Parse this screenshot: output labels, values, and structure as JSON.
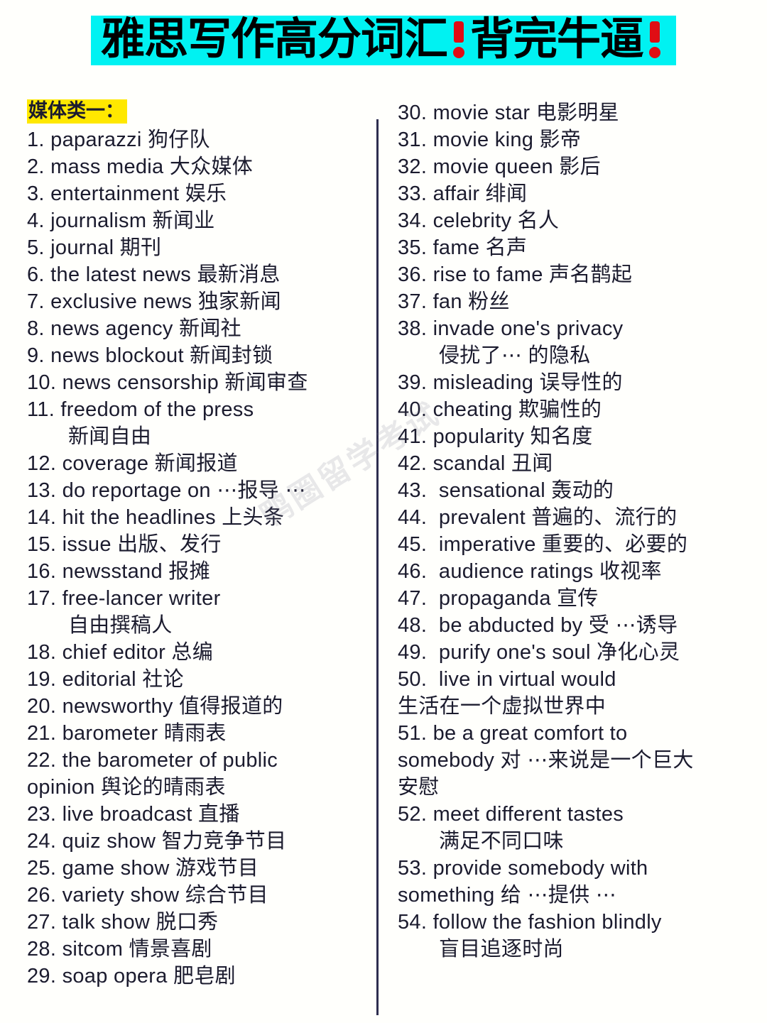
{
  "title": {
    "part1": "雅思写作高分词汇",
    "bang1": "!",
    "part2": "背完牛逼",
    "bang2": "!",
    "banner_bg": "#00f2f2",
    "bang_color": "#e00d14"
  },
  "watermark": {
    "text": "鸭圈留学考试"
  },
  "left_column": {
    "section_header": "媒体类一：",
    "section_header_highlight": "#ffe800",
    "items": [
      {
        "num": "1.",
        "text": "paparazzi 狗仔队"
      },
      {
        "num": "2.",
        "text": "mass media 大众媒体"
      },
      {
        "num": "3.",
        "text": "entertainment 娱乐"
      },
      {
        "num": "4.",
        "text": "journalism 新闻业"
      },
      {
        "num": "5.",
        "text": "journal 期刊"
      },
      {
        "num": "6.",
        "text": "the latest news 最新消息"
      },
      {
        "num": "7.",
        "text": "exclusive news 独家新闻"
      },
      {
        "num": "8.",
        "text": "news agency 新闻社"
      },
      {
        "num": "9.",
        "text": "news blockout 新闻封锁"
      },
      {
        "num": "10.",
        "text": "news censorship 新闻审查"
      },
      {
        "num": "11.",
        "text": "freedom of the press",
        "cont": "新闻自由",
        "cont_style": "indent"
      },
      {
        "num": "12.",
        "text": "coverage 新闻报道"
      },
      {
        "num": "13.",
        "text": "do reportage on ⋯报导 ⋯"
      },
      {
        "num": "14.",
        "text": "hit the headlines 上头条"
      },
      {
        "num": "15.",
        "text": "issue 出版、发行"
      },
      {
        "num": "16.",
        "text": "newsstand 报摊"
      },
      {
        "num": "17.",
        "text": "free-lancer writer",
        "cont": "自由撰稿人",
        "cont_style": "indent"
      },
      {
        "num": "18.",
        "text": "chief editor 总编"
      },
      {
        "num": "19.",
        "text": "editorial 社论"
      },
      {
        "num": "20.",
        "text": "newsworthy 值得报道的"
      },
      {
        "num": "21.",
        "text": "barometer 晴雨表"
      },
      {
        "num": "22.",
        "text": "the barometer of public",
        "cont": "opinion 舆论的晴雨表",
        "cont_style": "flush"
      },
      {
        "num": "23.",
        "text": "live broadcast 直播"
      },
      {
        "num": "24.",
        "text": "quiz show 智力竞争节目"
      },
      {
        "num": "25.",
        "text": "game show 游戏节目"
      },
      {
        "num": "26.",
        "text": "variety show 综合节目"
      },
      {
        "num": "27.",
        "text": "talk show 脱口秀"
      },
      {
        "num": "28.",
        "text": "sitcom 情景喜剧"
      },
      {
        "num": "29.",
        "text": "soap opera 肥皂剧"
      }
    ]
  },
  "right_column": {
    "items": [
      {
        "num": "30.",
        "text": "movie star 电影明星"
      },
      {
        "num": "31.",
        "text": "movie king 影帝"
      },
      {
        "num": "32.",
        "text": "movie queen 影后"
      },
      {
        "num": "33.",
        "text": "affair 绯闻"
      },
      {
        "num": "34.",
        "text": "celebrity 名人"
      },
      {
        "num": "35.",
        "text": "fame 名声"
      },
      {
        "num": "36.",
        "text": "rise to fame 声名鹊起"
      },
      {
        "num": "37.",
        "text": "fan 粉丝"
      },
      {
        "num": "38.",
        "text": "invade one's privacy",
        "cont": "侵扰了⋯ 的隐私",
        "cont_style": "indent"
      },
      {
        "num": "39.",
        "text": "misleading 误导性的"
      },
      {
        "num": "40.",
        "text": "cheating 欺骗性的"
      },
      {
        "num": "41.",
        "text": "popularity 知名度"
      },
      {
        "num": "42.",
        "text": "scandal 丑闻"
      },
      {
        "num": "43.",
        "text": " sensational 轰动的"
      },
      {
        "num": "44.",
        "text": " prevalent 普遍的、流行的"
      },
      {
        "num": "45.",
        "text": " imperative 重要的、必要的"
      },
      {
        "num": "46.",
        "text": " audience ratings 收视率"
      },
      {
        "num": "47.",
        "text": " propaganda 宣传"
      },
      {
        "num": "48.",
        "text": " be abducted by 受 ⋯诱导"
      },
      {
        "num": "49.",
        "text": " purify one's soul 净化心灵"
      },
      {
        "num": "50.",
        "text": " live in virtual would",
        "cont": "生活在一个虚拟世界中",
        "cont_style": "flush"
      },
      {
        "num": "51.",
        "text": "be a great comfort to",
        "cont": "somebody 对 ⋯来说是一个巨大\n安慰",
        "cont_style": "flush"
      },
      {
        "num": "52.",
        "text": "meet different tastes",
        "cont": "满足不同口味",
        "cont_style": "indent"
      },
      {
        "num": "53.",
        "text": "provide somebody with",
        "cont": "something 给 ⋯提供 ⋯",
        "cont_style": "flush"
      },
      {
        "num": "54.",
        "text": "follow the fashion blindly",
        "cont": "盲目追逐时尚",
        "cont_style": "indent"
      }
    ]
  }
}
